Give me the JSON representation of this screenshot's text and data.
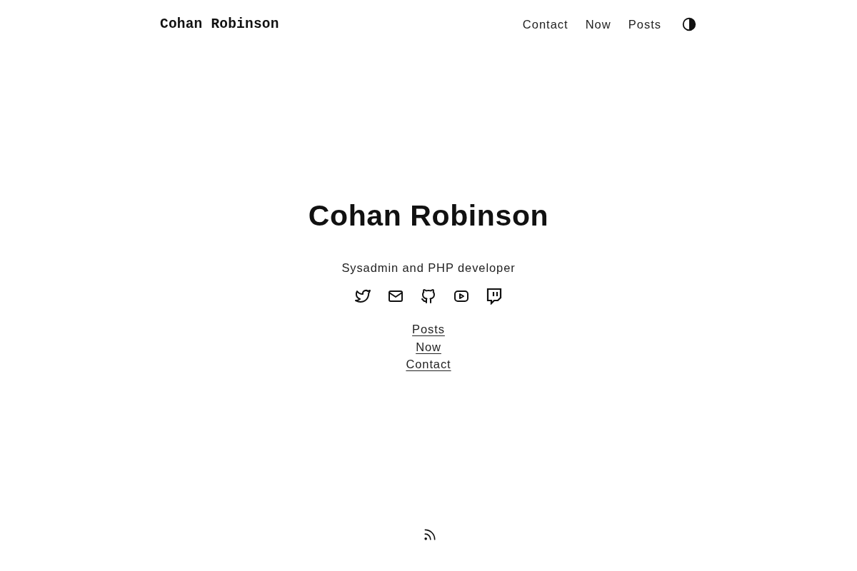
{
  "header": {
    "logo": "Cohan Robinson",
    "nav": [
      "Contact",
      "Now",
      "Posts"
    ]
  },
  "hero": {
    "title": "Cohan Robinson",
    "subtitle": "Sysadmin and PHP developer",
    "links": [
      "Posts",
      "Now",
      "Contact"
    ]
  }
}
